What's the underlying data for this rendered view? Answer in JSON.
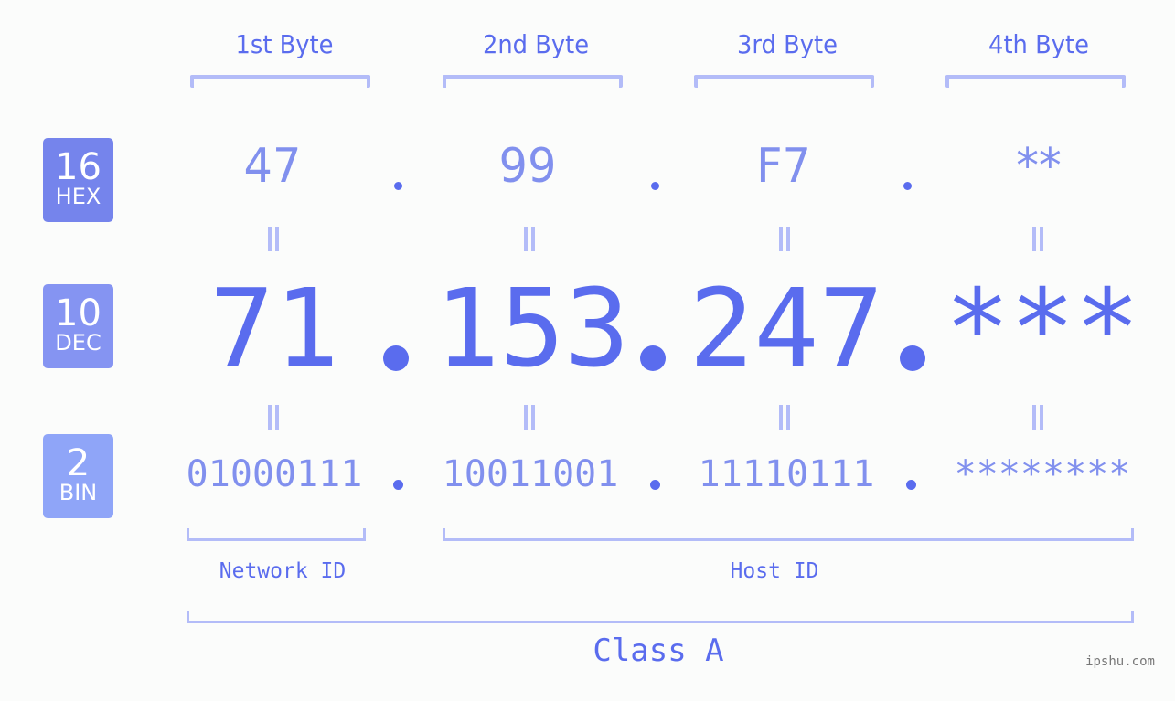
{
  "headers": [
    "1st Byte",
    "2nd Byte",
    "3rd Byte",
    "4th Byte"
  ],
  "rows": {
    "hex": {
      "base": "16",
      "label": "HEX",
      "values": [
        "47",
        "99",
        "F7",
        "**"
      ]
    },
    "dec": {
      "base": "10",
      "label": "DEC",
      "values": [
        "71",
        "153",
        "247",
        "***"
      ]
    },
    "bin": {
      "base": "2",
      "label": "BIN",
      "values": [
        "01000111",
        "10011001",
        "11110111",
        "********"
      ]
    }
  },
  "separator": ".",
  "network_id_label": "Network ID",
  "host_id_label": "Host ID",
  "class_label": "Class A",
  "watermark": "ipshu.com",
  "colors": {
    "primary": "#5a6cee",
    "secondary": "#8190ee",
    "bracket": "#b3bcf8",
    "hex_badge": "#7584ec",
    "dec_badge": "#8594f2",
    "bin_badge": "#8fa5f8",
    "background": "#fbfcfb"
  }
}
